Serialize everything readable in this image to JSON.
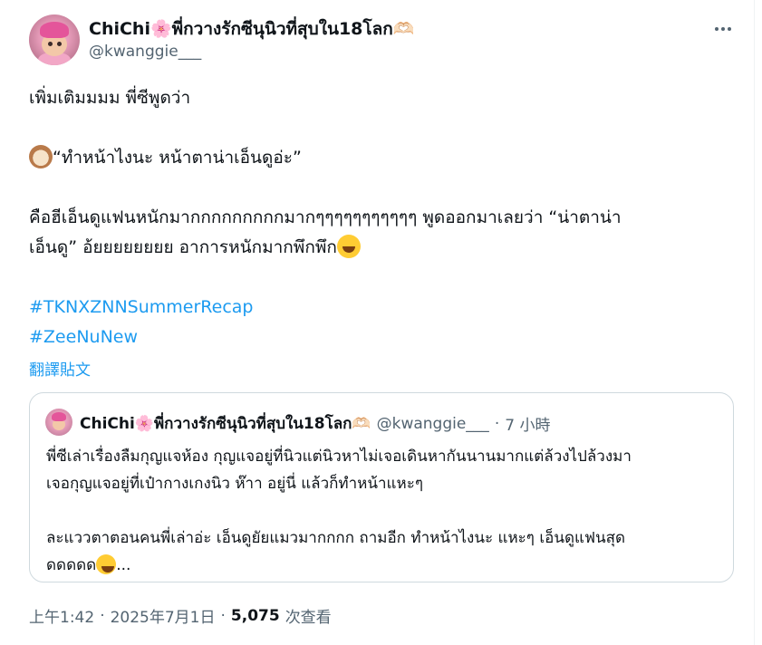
{
  "author": {
    "display_name": "ChiChi🌸พี่กวางรักซีนุนิวที่สุบใน18โลก🫶🏻",
    "handle": "@kwanggie___"
  },
  "more_icon": "more-horizontal-icon",
  "tweet": {
    "line1": "เพิ่มเติมมมม พี่ซีพูดว่า",
    "line2_emoji": "dog-face",
    "line2_text": "“ทำหน้าไงนะ หน้าตาน่าเอ็นดูอ่ะ”",
    "line3": "คือฮีเอ็นดูแฟนหนักมากกกกกกกกกมากๆๆๆๆๆๆๆๆๆๆๆ พูดออกมาเลยว่า “น่าตาน่า",
    "line4": "เอ็นดู” อ้ยยยยยยยย อาการหนักมากพึกพึก",
    "line4_emoji": "grinning-squinting-face",
    "hashtag1": "#TKNXZNNSummerRecap",
    "hashtag2": "#ZeeNuNew"
  },
  "translate_label": "翻譯貼文",
  "quote": {
    "display_name": "ChiChi🌸พี่กวางรักซีนุนิวที่สุบใน18โลก🫶🏻",
    "handle": "@kwanggie___",
    "separator": "·",
    "time": "7 小時",
    "p1_line1": "พี่ซีเล่าเรื่องลืมกุญแจห้อง กุญแจอยู่ที่นิวแต่นิวหาไม่เจอเดินหากันนานมากแต่ล้วงไปล้วงมา",
    "p1_line2": "เจอกุญแจอยู่ที่เป๋ากางเกงนิว ห๊าา อยู่นี่ แล้วก็ทำหน้าแหะๆ",
    "p2_line1": "ละแววตาตอนคนพี่เล่าอ่ะ เอ็นดูยัยแมวมากกกก ถามอีก ทำหน้าไงนะ แหะๆ เอ็นดูแฟนสุด",
    "p2_line2": "ดดดดด",
    "p2_ellipsis": "..."
  },
  "meta": {
    "time": "上午1:42",
    "sep1": "·",
    "date": "2025年7月1日",
    "sep2": "·",
    "views_count": "5,075",
    "views_label": "次查看"
  }
}
